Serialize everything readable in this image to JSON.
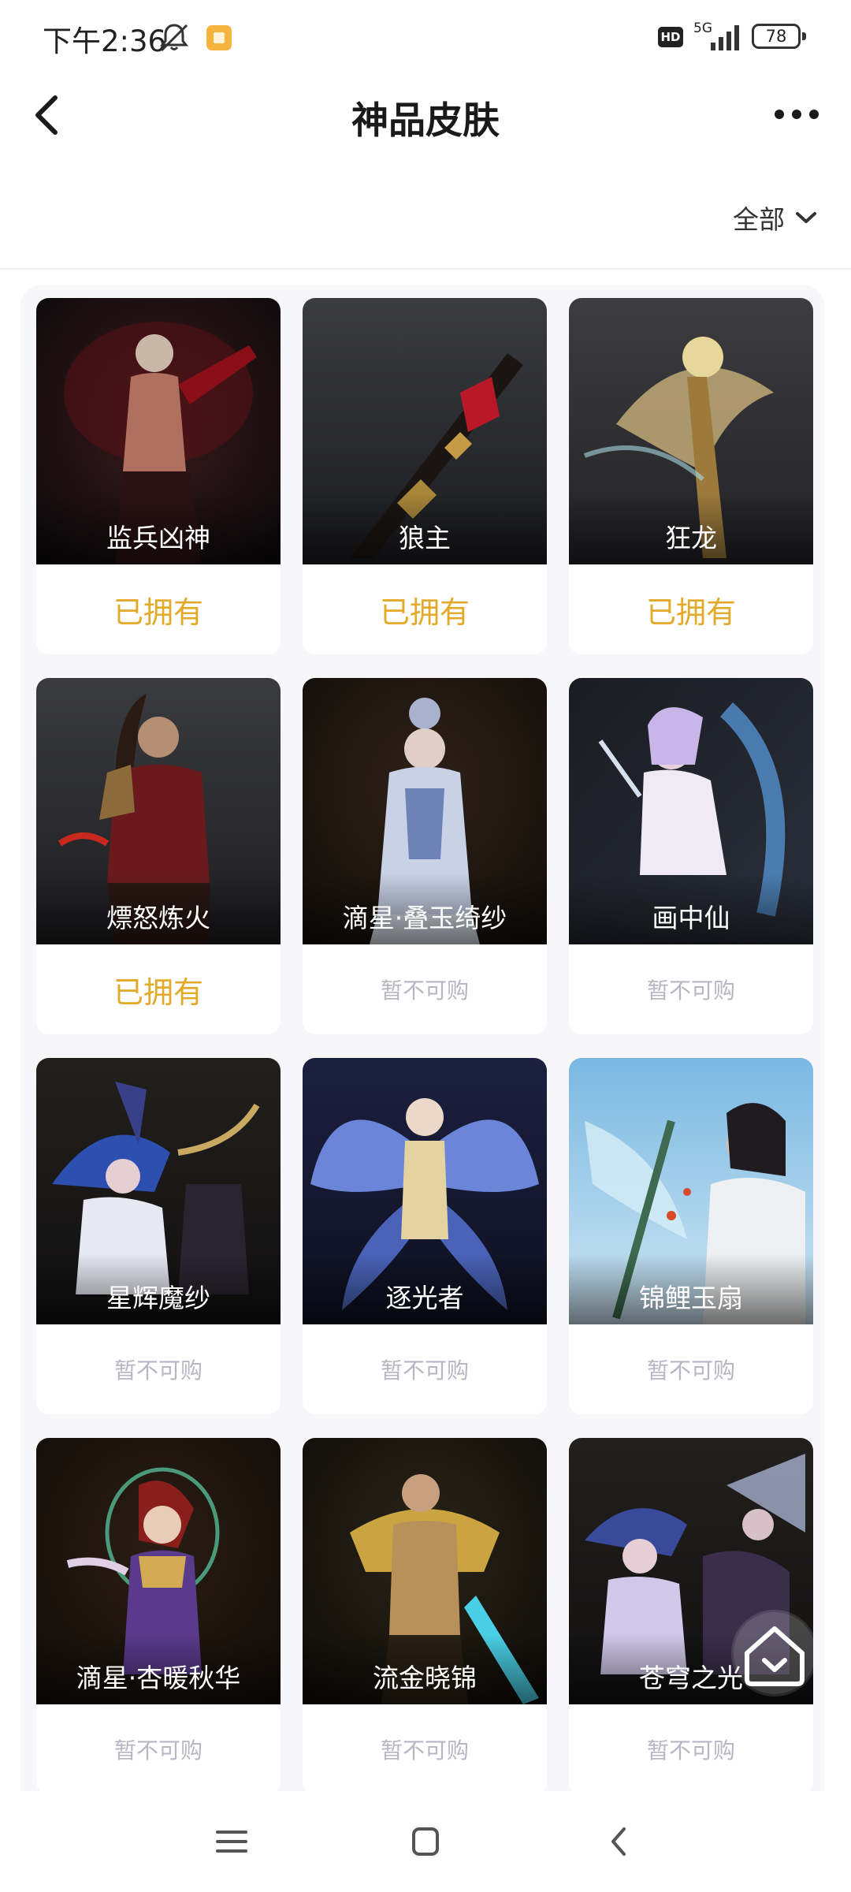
{
  "status_bar": {
    "time": "下午2:36",
    "network": "5G",
    "hd_label": "HD",
    "battery": "78"
  },
  "header": {
    "title": "神品皮肤"
  },
  "filter": {
    "label": "全部"
  },
  "skins": [
    {
      "name": "监兵凶神",
      "status": "已拥有",
      "state": "owned"
    },
    {
      "name": "狼主",
      "status": "已拥有",
      "state": "owned"
    },
    {
      "name": "狂龙",
      "status": "已拥有",
      "state": "owned"
    },
    {
      "name": "熛怒炼火",
      "status": "已拥有",
      "state": "owned"
    },
    {
      "name": "滴星·叠玉绮纱",
      "status": "暂不可购",
      "state": "unavailable"
    },
    {
      "name": "画中仙",
      "status": "暂不可购",
      "state": "unavailable"
    },
    {
      "name": "星辉魔纱",
      "status": "暂不可购",
      "state": "unavailable"
    },
    {
      "name": "逐光者",
      "status": "暂不可购",
      "state": "unavailable"
    },
    {
      "name": "锦鲤玉扇",
      "status": "暂不可购",
      "state": "unavailable"
    },
    {
      "name": "滴星·杏暖秋华",
      "status": "暂不可购",
      "state": "unavailable"
    },
    {
      "name": "流金晓锦",
      "status": "暂不可购",
      "state": "unavailable"
    },
    {
      "name": "苍穹之光",
      "status": "暂不可购",
      "state": "unavailable"
    }
  ],
  "colors": {
    "owned": "#e3a929",
    "unavailable": "#b8b6c2",
    "title": "#1a1a1a"
  },
  "icons": {
    "back": "chevron-left-icon",
    "more": "more-dots-icon",
    "filter": "chevron-down-icon",
    "home_fab": "home-icon",
    "nav_menu": "menu-icon",
    "nav_home": "square-home-icon",
    "nav_back": "back-triangle-icon"
  }
}
